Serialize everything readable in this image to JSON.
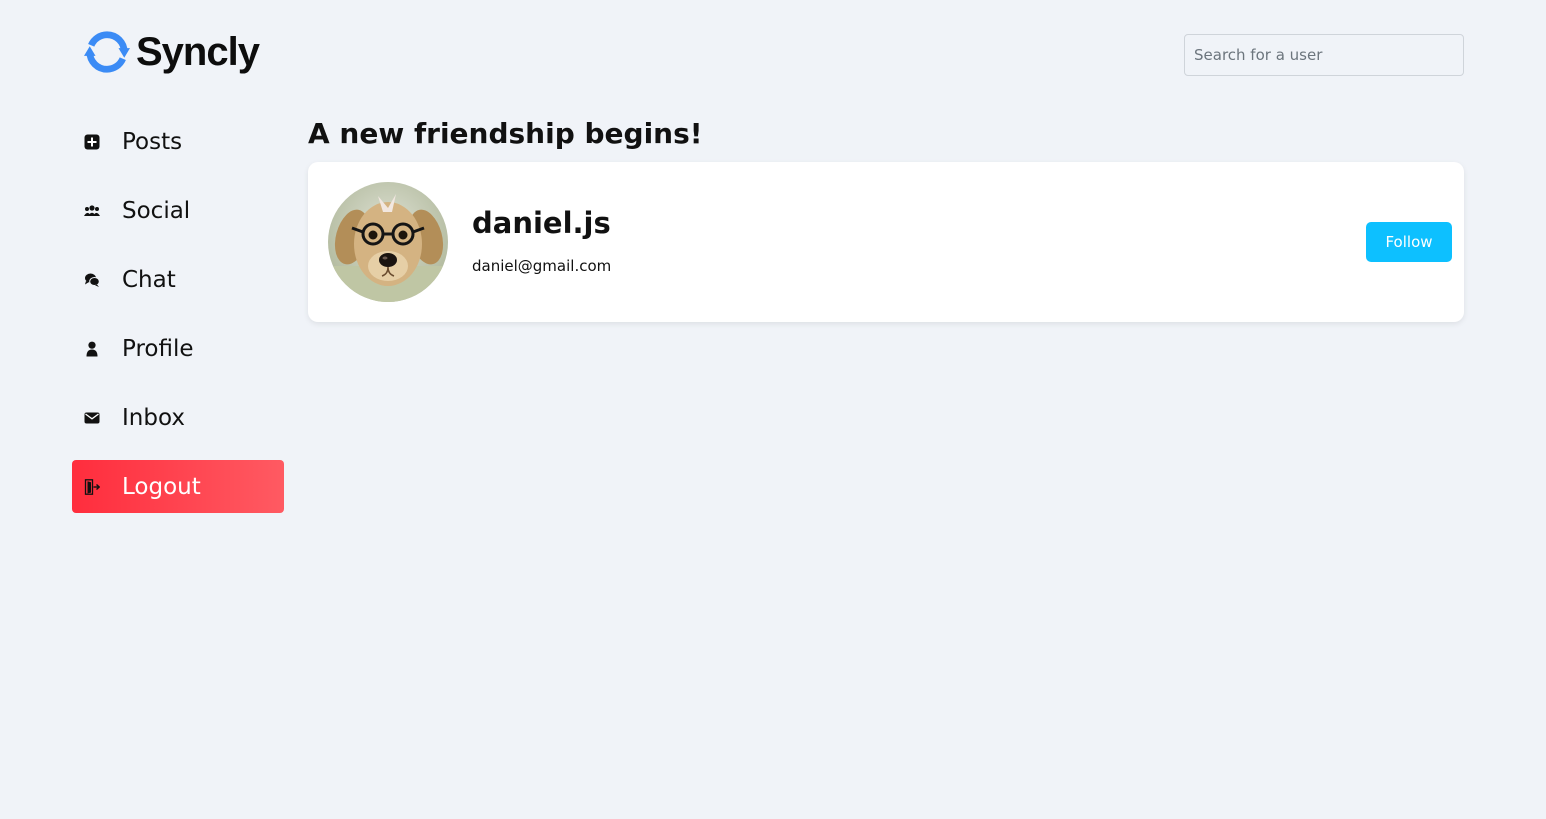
{
  "brand": {
    "name": "Syncly",
    "logo_icon": "sync-arrows-icon",
    "accent": "#3b8bf5"
  },
  "search": {
    "placeholder": "Search for a user",
    "value": ""
  },
  "sidebar": {
    "items": [
      {
        "label": "Posts",
        "icon": "plus-square-icon"
      },
      {
        "label": "Social",
        "icon": "users-icon"
      },
      {
        "label": "Chat",
        "icon": "chat-bubbles-icon"
      },
      {
        "label": "Profile",
        "icon": "user-icon"
      },
      {
        "label": "Inbox",
        "icon": "envelope-icon"
      },
      {
        "label": "Logout",
        "icon": "logout-door-icon",
        "color": "#ff3b47"
      }
    ]
  },
  "main": {
    "title": "A new friendship begins!",
    "users": [
      {
        "username": "daniel.js",
        "email": "daniel@gmail.com",
        "avatar": "puppy-with-glasses-avatar",
        "follow_label": "Follow",
        "follow_color": "#0dc0ff"
      }
    ]
  }
}
